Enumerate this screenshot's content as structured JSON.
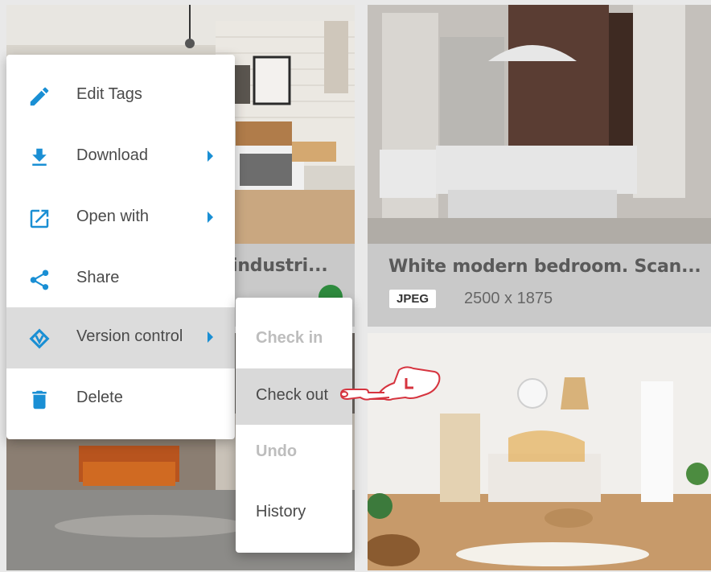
{
  "cards": [
    {
      "title": "industri...",
      "badge": "",
      "dims": ""
    },
    {
      "title": "White modern bedroom. Scan...",
      "badge": "JPEG",
      "dims": "2500 x 1875"
    }
  ],
  "context_menu": {
    "items": [
      {
        "label": "Edit Tags",
        "icon": "pencil-icon",
        "has_submenu": false
      },
      {
        "label": "Download",
        "icon": "download-icon",
        "has_submenu": true
      },
      {
        "label": "Open with",
        "icon": "open-external-icon",
        "has_submenu": true
      },
      {
        "label": "Share",
        "icon": "share-icon",
        "has_submenu": false
      },
      {
        "label": "Version control",
        "icon": "version-control-icon",
        "has_submenu": true,
        "active": true
      },
      {
        "label": "Delete",
        "icon": "trash-icon",
        "has_submenu": false
      }
    ]
  },
  "version_submenu": {
    "items": [
      {
        "label": "Check in",
        "enabled": false
      },
      {
        "label": "Check out",
        "enabled": true,
        "hovered": true
      },
      {
        "label": "Undo",
        "enabled": false
      },
      {
        "label": "History",
        "enabled": true
      }
    ]
  },
  "colors": {
    "accent": "#1a8fd4",
    "hover": "#dcdcdc",
    "badge_green": "#2e8b3e",
    "pointer": "#d6343f"
  }
}
